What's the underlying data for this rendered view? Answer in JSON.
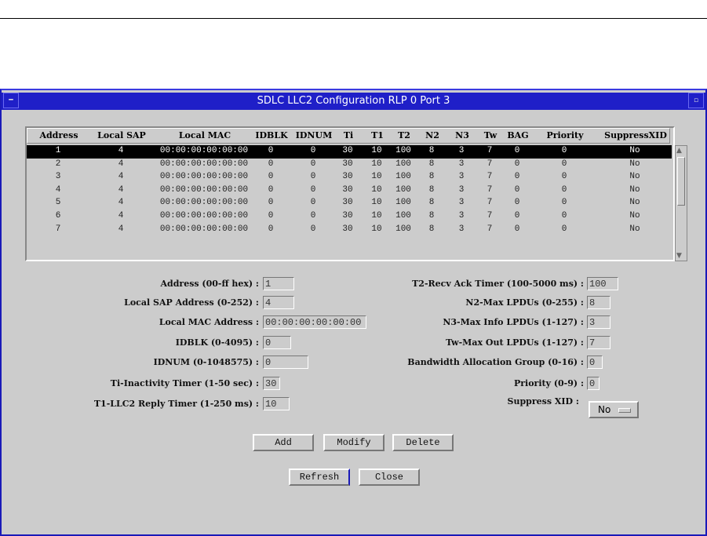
{
  "window": {
    "title": "SDLC LLC2 Configuration  RLP 0 Port 3"
  },
  "table": {
    "columns": [
      "Address",
      "Local SAP",
      "Local MAC",
      "IDBLK",
      "IDNUM",
      "Ti",
      "T1",
      "T2",
      "N2",
      "N3",
      "Tw",
      "BAG",
      "Priority",
      "SuppressXID"
    ],
    "rows": [
      [
        "1",
        "4",
        "00:00:00:00:00:00",
        "0",
        "0",
        "30",
        "10",
        "100",
        "8",
        "3",
        "7",
        "0",
        "0",
        "No"
      ],
      [
        "2",
        "4",
        "00:00:00:00:00:00",
        "0",
        "0",
        "30",
        "10",
        "100",
        "8",
        "3",
        "7",
        "0",
        "0",
        "No"
      ],
      [
        "3",
        "4",
        "00:00:00:00:00:00",
        "0",
        "0",
        "30",
        "10",
        "100",
        "8",
        "3",
        "7",
        "0",
        "0",
        "No"
      ],
      [
        "4",
        "4",
        "00:00:00:00:00:00",
        "0",
        "0",
        "30",
        "10",
        "100",
        "8",
        "3",
        "7",
        "0",
        "0",
        "No"
      ],
      [
        "5",
        "4",
        "00:00:00:00:00:00",
        "0",
        "0",
        "30",
        "10",
        "100",
        "8",
        "3",
        "7",
        "0",
        "0",
        "No"
      ],
      [
        "6",
        "4",
        "00:00:00:00:00:00",
        "0",
        "0",
        "30",
        "10",
        "100",
        "8",
        "3",
        "7",
        "0",
        "0",
        "No"
      ],
      [
        "7",
        "4",
        "00:00:00:00:00:00",
        "0",
        "0",
        "30",
        "10",
        "100",
        "8",
        "3",
        "7",
        "0",
        "0",
        "No"
      ]
    ],
    "selected_row": 0
  },
  "form": {
    "left": [
      {
        "label": "Address (00-ff hex) :",
        "value": "1"
      },
      {
        "label": "Local SAP Address (0-252) :",
        "value": "4"
      },
      {
        "label": "Local MAC Address :",
        "value": "00:00:00:00:00:00"
      },
      {
        "label": "IDBLK (0-4095) :",
        "value": "0"
      },
      {
        "label": "IDNUM (0-1048575) :",
        "value": "0"
      },
      {
        "label": "Ti-Inactivity Timer (1-50 sec) :",
        "value": "30"
      },
      {
        "label": "T1-LLC2 Reply Timer (1-250 ms) :",
        "value": "10"
      }
    ],
    "right": [
      {
        "label": "T2-Recv Ack Timer (100-5000 ms) :",
        "value": "100"
      },
      {
        "label": "N2-Max LPDUs (0-255) :",
        "value": "8"
      },
      {
        "label": "N3-Max Info LPDUs (1-127) :",
        "value": "3"
      },
      {
        "label": "Tw-Max Out LPDUs (1-127) :",
        "value": "7"
      },
      {
        "label": "Bandwidth Allocation Group (0-16) :",
        "value": "0"
      },
      {
        "label": "Priority (0-9) :",
        "value": "0"
      }
    ],
    "suppress": {
      "label": "Suppress XID :",
      "value": "No"
    }
  },
  "buttons": {
    "add": "Add",
    "modify": "Modify",
    "delete": "Delete",
    "refresh": "Refresh",
    "close": "Close"
  }
}
